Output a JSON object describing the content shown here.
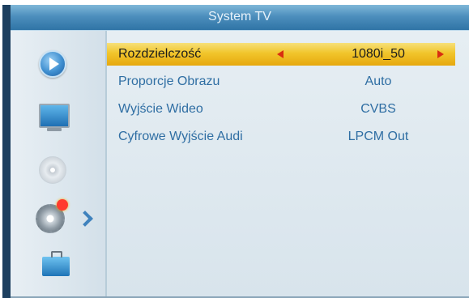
{
  "window": {
    "title": "System TV"
  },
  "sidebar": {
    "items": [
      {
        "name": "play",
        "icon": "play-icon",
        "active": false
      },
      {
        "name": "tv",
        "icon": "monitor-icon",
        "active": false
      },
      {
        "name": "media",
        "icon": "disc-icon",
        "active": false
      },
      {
        "name": "settings",
        "icon": "gear-icon",
        "active": true
      },
      {
        "name": "tools",
        "icon": "toolbox-icon",
        "active": false
      }
    ]
  },
  "settings": {
    "rows": [
      {
        "label": "Rozdzielczość",
        "value": "1080i_50",
        "selected": true
      },
      {
        "label": "Proporcje Obrazu",
        "value": "Auto",
        "selected": false
      },
      {
        "label": "Wyjście Wideo",
        "value": "CVBS",
        "selected": false
      },
      {
        "label": "Cyfrowe Wyjście Audi",
        "value": "LPCM Out",
        "selected": false
      }
    ]
  },
  "colors": {
    "title_bar": "#4d8fbd",
    "highlight": "#f1c52b",
    "text": "#2f6ea3",
    "arrow": "#d92e10"
  }
}
